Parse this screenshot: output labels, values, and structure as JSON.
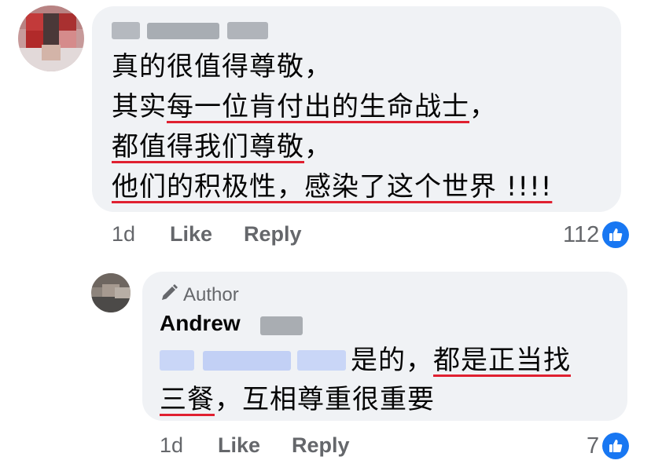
{
  "comment": {
    "lines": [
      {
        "plain": "真的很值得尊敬，",
        "underlined": "",
        "tail": ""
      },
      {
        "plain": "其实",
        "underlined": "每一位肯付出的生命战士",
        "tail": "，"
      },
      {
        "plain": "",
        "underlined": "都值得我们尊敬",
        "tail": "，"
      },
      {
        "plain": "",
        "underlined": "他们的积极性，感染了这个世界 !!!!",
        "tail": ""
      }
    ],
    "age": "1d",
    "like_label": "Like",
    "reply_label": "Reply",
    "reaction_count": "112",
    "reaction_icon": "thumbs-up-icon"
  },
  "reply": {
    "author_tag": "Author",
    "author_tag_icon": "pencil-icon",
    "author_first_name": "Andrew",
    "text_before": "是的，",
    "text_underlined_1": "都是正当找",
    "text_underlined_2": "三餐",
    "text_after": "，互相尊重很重要",
    "age": "1d",
    "like_label": "Like",
    "reply_label": "Reply",
    "reaction_count": "7",
    "reaction_icon": "thumbs-up-icon"
  },
  "colors": {
    "bubble": "#f0f2f5",
    "underline": "#e02030",
    "secondary_text": "#65676b",
    "like_blue": "#1877f2",
    "mention_blur": "#c9d6f7"
  }
}
